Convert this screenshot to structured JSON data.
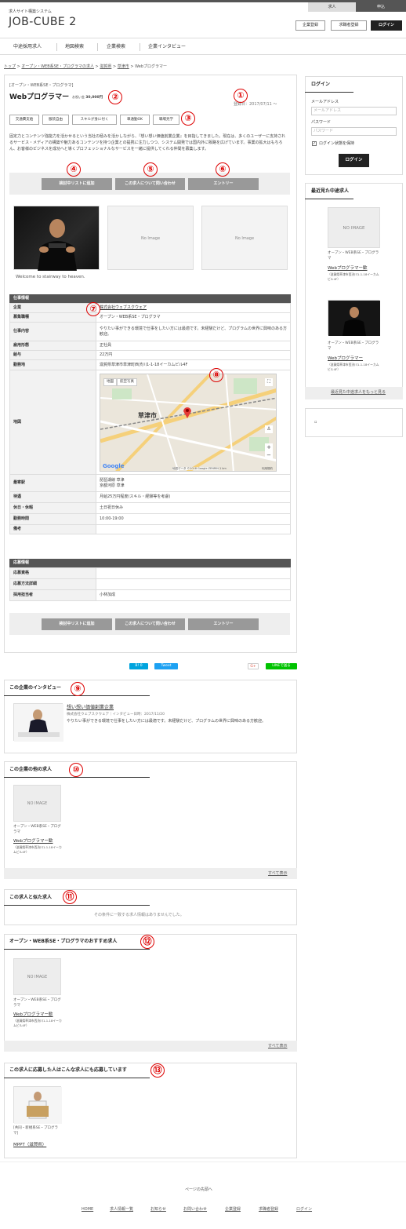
{
  "header": {
    "switch_left": "求人",
    "switch_right": "申込",
    "logo_sub": "求人サイト構築システム",
    "logo": "JOB-CUBE 2",
    "btn_company": "企業登録",
    "btn_seeker": "求職者登録",
    "btn_login": "ログイン"
  },
  "nav": [
    "中途採用求人",
    "地図検索",
    "企業検索",
    "企業インタビュー"
  ],
  "breadcrumb": [
    "トップ",
    "オープン・WEB系SE・プログラマの求人",
    "滋賀県",
    "草津市",
    "Webプログラマー"
  ],
  "job": {
    "category": "[オープン・WEB系SE・プログラマ]",
    "title": "Webプログラマー",
    "salary_label": "お祝い金",
    "salary_value": "30,000円",
    "reg_date": "登録日：2017/07/11 〜",
    "tags": [
      "交通費支給",
      "服装自由",
      "スキルが身に付く",
      "車通勤OK",
      "職場見学"
    ],
    "description": "固定力とコンテンツ強能力を活かせるという当社の極みを活かしながら、『想い想い価値創業企業』を目指してきました。現在は、多くのユーザーに支持されるサービス・メディアの構築や魅力あるコンテンツを持つ企業との提携に注力しつつ、システム開発では国内外に販路を広げています。事業の拡大はもちろん、お客様のビジネスを成功へと導くプロフェッショナルなサービスを一緒に提供してくれる仲間を募集します。",
    "actions": [
      "検討中リストに追加",
      "この求人について問い合わせ",
      "エントリー"
    ],
    "images": [
      "",
      "No Image",
      "No Image"
    ],
    "caption": "Welcome to stairway to heaven.",
    "section1_title": "仕事情報",
    "rows": [
      {
        "k": "企業",
        "v": "株式会社ウェブスクウェア"
      },
      {
        "k": "募集職種",
        "v": "オープン・WEB系SE・プログラマ"
      },
      {
        "k": "仕事内容",
        "v": "やりたい事ができる環境で仕事をしたい方には最適です。未経験だけど、プログラムの世界に興味のある方歓迎。"
      },
      {
        "k": "雇用形態",
        "v": "正社員"
      },
      {
        "k": "給与",
        "v": "22万円"
      },
      {
        "k": "勤務地",
        "v": "滋賀県草津市草津町西渋川1-1-18イーカムビル4F"
      },
      {
        "k": "地図",
        "v": ""
      },
      {
        "k": "最寄駅",
        "v": "琵琶湖線 草津\n京都河原 草津"
      },
      {
        "k": "待遇",
        "v": "月給25万円程度(スキル・経験等を考慮)"
      },
      {
        "k": "休日・休暇",
        "v": "土日祝日休み"
      },
      {
        "k": "勤務時間",
        "v": "10:00-19:00"
      },
      {
        "k": "備考",
        "v": ""
      }
    ],
    "section2_title": "応募情報",
    "rows2": [
      {
        "k": "応募資格",
        "v": ""
      },
      {
        "k": "応募方法詳細",
        "v": ""
      },
      {
        "k": "採用担当者",
        "v": "小林加成"
      }
    ],
    "map": {
      "tab_map": "地図",
      "tab_sat": "航空写真",
      "city": "草津市",
      "footer": "地図データ ©2018 Google ZENRIN",
      "scale": "1 km",
      "terms": "利用規約",
      "google": "Google"
    }
  },
  "share": {
    "hatena": "B! 0",
    "tweet": "Tweet",
    "gplus": "G+",
    "line": "LINEで送る"
  },
  "interview": {
    "title": "この企業のインタビュー",
    "link": "想い想い価値創業企業",
    "meta": "株式会社ウェブスクウェア｜インタビュー日時：2017/11/20",
    "text": "やりたい事ができる環境で仕事をしたい方には最適です。未経験だけど、プログラムの世界に興味のある方歓迎。"
  },
  "other_jobs": {
    "title": "この企業の他の求人",
    "card_img": "NO IMAGE",
    "card_cat": "オープン・WEB系SE・プログラマ",
    "card_link": "Webプログラマー歓",
    "card_addr": "（滋賀県草津市西渋川1-1-18イーカムビル4F）",
    "more": "すべて表示"
  },
  "similar": {
    "title": "この求人と似た求人",
    "empty": "その条件に一致する求人情報はありませんでした。"
  },
  "recommend": {
    "title": "オープン・WEB系SE・プログラマのおすすめ求人",
    "card_img": "NO IMAGE",
    "card_cat": "オープン・WEB系SE・プログラマ",
    "card_link": "Webプログラマー歓",
    "card_addr": "（滋賀県草津市西渋川1-1-18イーカムビル4F）",
    "more": "すべて表示"
  },
  "also_applied": {
    "title": "この求人に応募した人はこんな求人にも応募しています",
    "card_cat": "[共同・新規系SE・プログラマ]",
    "card_link": "MPPT（滋賀県）"
  },
  "sidebar": {
    "login_title": "ログイン",
    "email_label": "メールアドレス",
    "email_placeholder": "メールアドレス",
    "pw_label": "パスワード",
    "pw_placeholder": "パスワード",
    "keep": "ログイン状態を保持",
    "login_btn": "ログイン",
    "recent_title": "最近見た中途求人",
    "recent1_img": "NO IMAGE",
    "recent1_cat": "オープン・WEB系SE・プログラマ",
    "recent1_link": "Webプログラマー歓",
    "recent1_addr": "（滋賀県草津市西渋川1-1-18イーカムビル4F）",
    "recent2_cat": "オープン・WEB系SE・プログラマ",
    "recent2_link": "Webプログラマー",
    "recent2_addr": "（滋賀県草津市西渋川1-1-18イーカムビル4F）",
    "recent_more": "最近見た中途求人をもっと見る"
  },
  "footer": {
    "pagetop": "ページの先頭へ",
    "links": [
      "HOME",
      "求人情報一覧",
      "お知らせ",
      "お問い合わせ",
      "企業登録",
      "求職者登録",
      "ログイン"
    ]
  },
  "markers": [
    "①",
    "②",
    "③",
    "④",
    "⑤",
    "⑥",
    "⑦",
    "⑧",
    "⑨",
    "⑩",
    "⑪",
    "⑫",
    "⑬"
  ]
}
